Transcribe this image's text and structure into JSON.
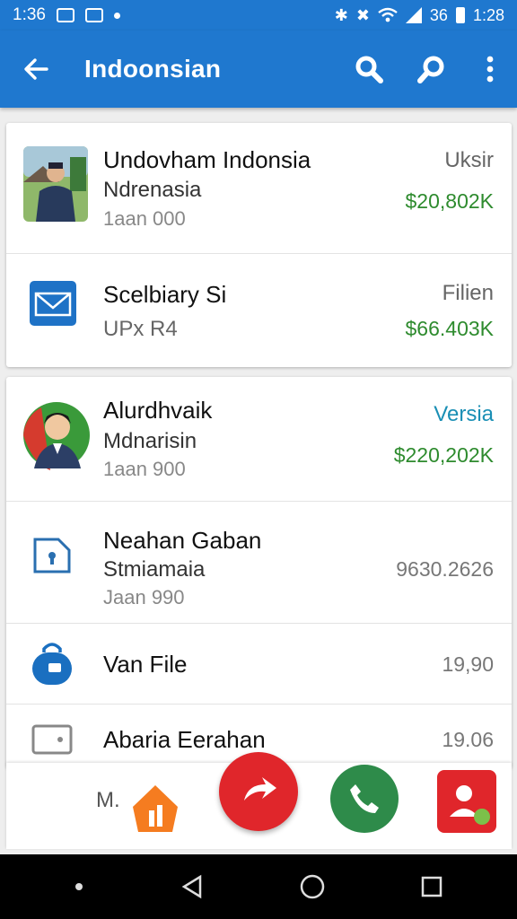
{
  "status_bar": {
    "time_left": "1:36",
    "time_right": "1:28",
    "battery_text": "36"
  },
  "app_bar": {
    "title": "Indoonsian"
  },
  "card1": {
    "rows": [
      {
        "primary": "Undovham Indonsia",
        "secondary": "Ndrenasia",
        "meta": "1aan 000",
        "right_label": "Uksir",
        "right_value": "$20,802K"
      },
      {
        "primary": "Scelbiary Si",
        "secondary": "UPx R4",
        "right_label": "Filien",
        "right_value": "$66.403K"
      }
    ]
  },
  "card2": {
    "rows": [
      {
        "primary": "Alurdhvaik",
        "secondary": "Mdnarisin",
        "meta": "1aan 900",
        "right_label": "Versia",
        "right_value": "$220,202K"
      },
      {
        "primary": "Neahan Gaban",
        "secondary": "Stmiamaia",
        "meta": "Jaan 990",
        "right_value": "9630.2626"
      },
      {
        "primary": "Van File",
        "right_value": "19,90"
      },
      {
        "primary": "Abaria Eerahan",
        "right_value": "19.06"
      }
    ]
  },
  "bottom_actions": {
    "label": "M."
  },
  "colors": {
    "primary": "#1f78cf",
    "money_green": "#2e8b2e",
    "fab_red": "#e0262b",
    "fab_green": "#2e8b4a",
    "fab_orange": "#f57c20"
  }
}
